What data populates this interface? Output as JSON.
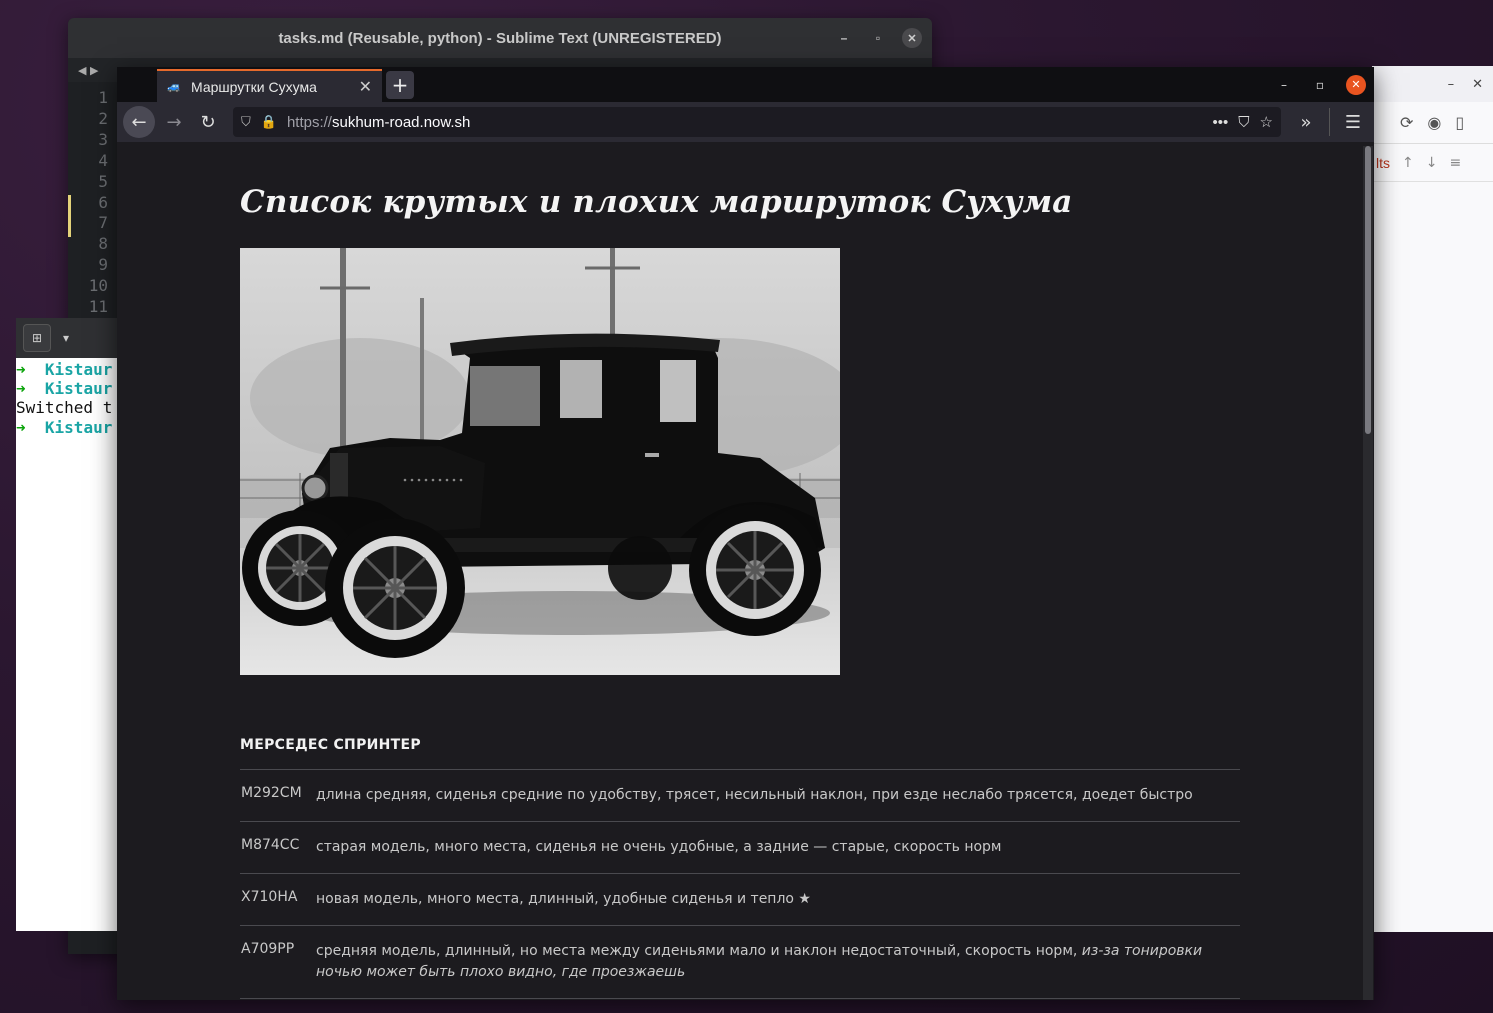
{
  "sublime": {
    "title": "tasks.md (Reusable, python) - Sublime Text (UNREGISTERED)",
    "line_numbers": [
      "1",
      "2",
      "3",
      "4",
      "5",
      "6",
      "7",
      "8",
      "9",
      "10",
      "11"
    ]
  },
  "terminal": {
    "lines": [
      {
        "prefix": "➜",
        "text": "Kistaur"
      },
      {
        "prefix": "➜",
        "text": "Kistaur"
      },
      {
        "prefix": "",
        "text": "Switched t"
      },
      {
        "prefix": "➜",
        "text": "Kistaur"
      }
    ]
  },
  "bg_firefox": {
    "results_label": "lts"
  },
  "firefox": {
    "tab_title": "Маршрутки Сухума",
    "url_scheme": "https://",
    "url_host": "sukhum-road.now.sh"
  },
  "page": {
    "title": "Список крутых и плохих маршруток Сухума",
    "section_title": "МЕРСЕДЕС СПРИНТЕР",
    "rows": [
      {
        "plate": "М292СМ",
        "desc": "длина средняя, сиденья средние по удобству, трясет, несильный наклон, при езде неслабо трясется, доедет быстро",
        "note": ""
      },
      {
        "plate": "М874СС",
        "desc": "старая модель, много места, сиденья не очень удобные, а задние — старые, скорость норм",
        "note": ""
      },
      {
        "plate": "Х710НА",
        "desc": "новая модель, много места, длинный, удобные сиденья и тепло ★",
        "note": ""
      },
      {
        "plate": "А709РР",
        "desc": "средняя модель, длинный, но места между сиденьями мало и наклон недостаточный, скорость норм, ",
        "note": "из-за тонировки ночью может быть плохо видно, где проезжаешь"
      }
    ]
  },
  "icons": {
    "back": "arrow-left-icon",
    "forward": "arrow-right-icon",
    "reload": "reload-icon",
    "shield": "shield-icon",
    "lock": "lock-icon",
    "more": "more-icon",
    "pocket": "pocket-icon",
    "bookmark": "star-icon",
    "overflow": "chevron-double-right-icon",
    "menu": "hamburger-menu-icon"
  },
  "colors": {
    "accent": "#e66a2c",
    "close_button": "#e95420",
    "terminal_arrow": "#0aa30a",
    "terminal_path": "#1aa5a5"
  }
}
